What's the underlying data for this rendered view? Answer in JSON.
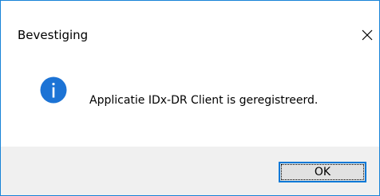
{
  "dialog": {
    "title": "Bevestiging",
    "message": "Applicatie IDx-DR Client is geregistreerd.",
    "icon": "info-icon",
    "ok_label": "OK"
  },
  "colors": {
    "window_border": "#1883d7",
    "info_icon_fill": "#1c73d5",
    "footer_background": "#f0f0f0",
    "button_border": "#0078d7",
    "button_background": "#e1e1e1"
  }
}
